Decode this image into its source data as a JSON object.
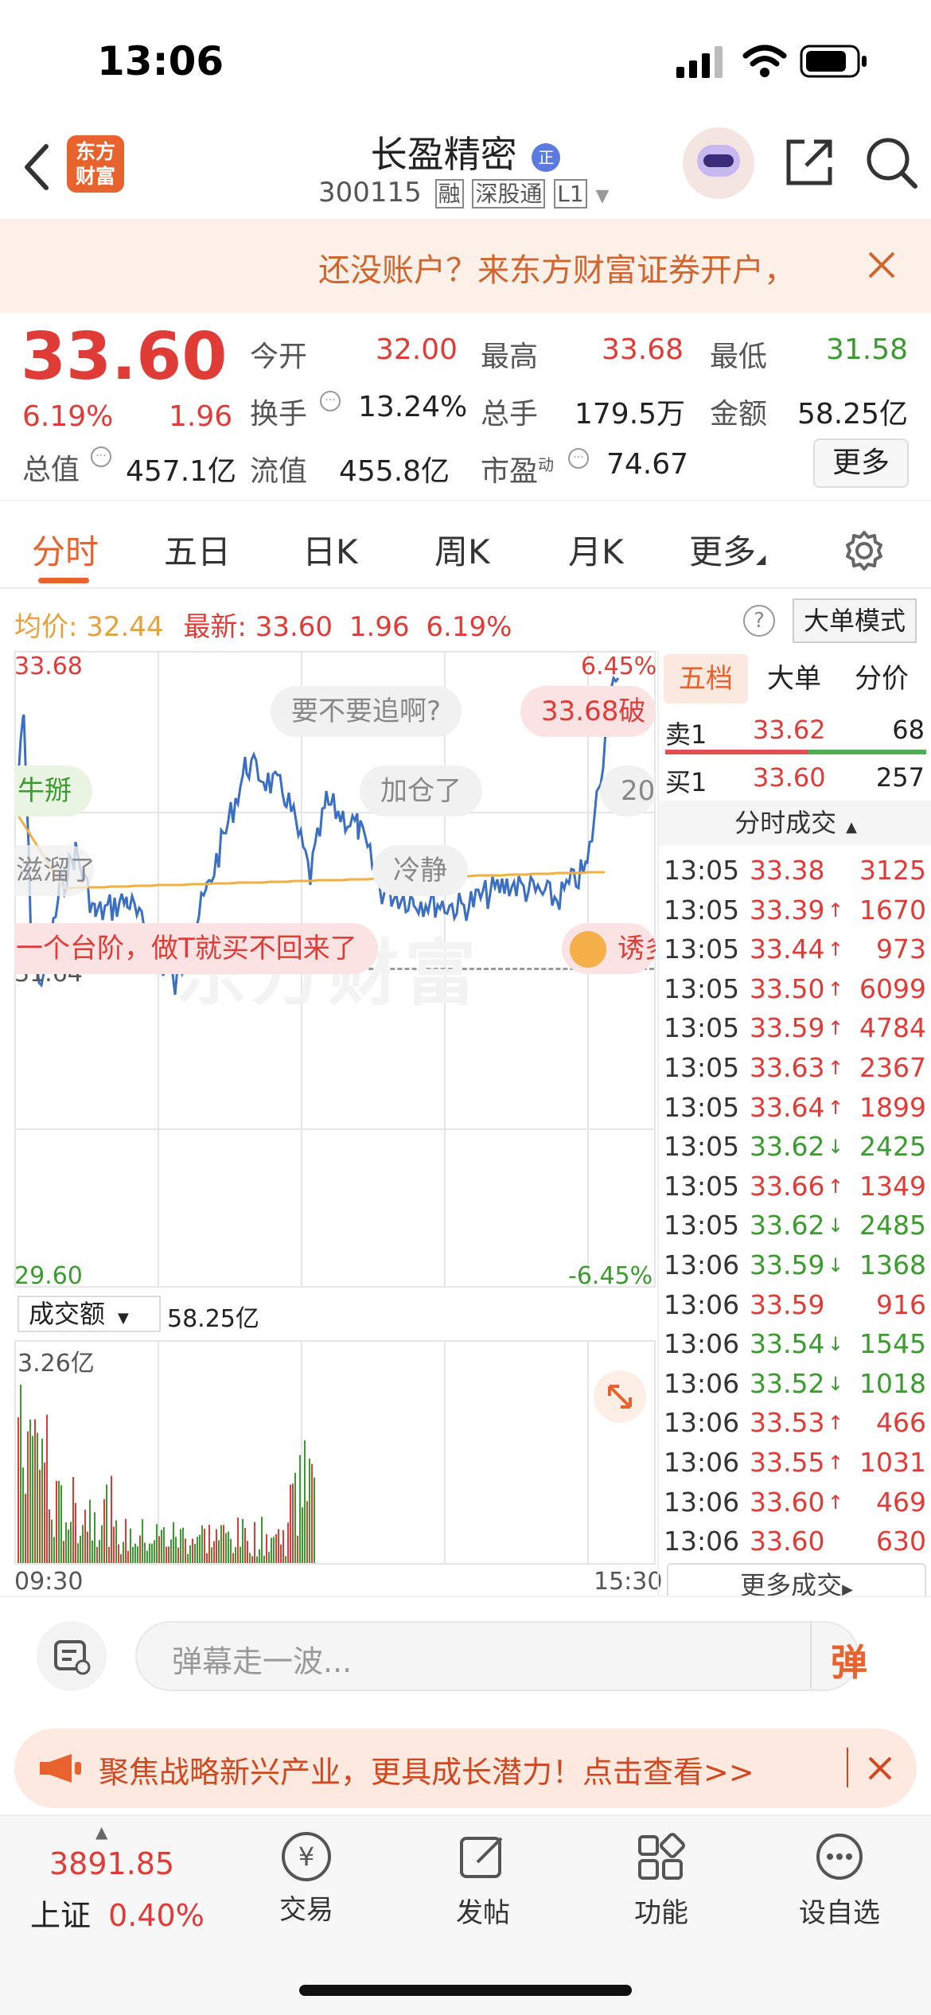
{
  "status_bar": {
    "time": "13:06"
  },
  "nav": {
    "logo_text_top": "东方",
    "logo_text_bottom": "财富",
    "stock_name": "长盈精密",
    "badge": "正",
    "stock_code": "300115",
    "tags": [
      "融",
      "深股通",
      "L1"
    ]
  },
  "banner": {
    "text": "还没账户？来东方财富证券开户，"
  },
  "quote": {
    "price": "33.60",
    "change_pct": "6.19%",
    "change": "1.96",
    "open_label": "今开",
    "open": "32.00",
    "high_label": "最高",
    "high": "33.68",
    "low_label": "最低",
    "low": "31.58",
    "turnover_label": "换手",
    "turnover": "13.24%",
    "volume_label": "总手",
    "volume": "179.5万",
    "amount_label": "金额",
    "amount": "58.25亿",
    "mktcap_label": "总值",
    "mktcap": "457.1亿",
    "float_label": "流值",
    "float": "455.8亿",
    "pe_label": "市盈",
    "pe_sup": "动",
    "pe": "74.67",
    "more_button": "更多"
  },
  "tabs": {
    "items": [
      "分时",
      "五日",
      "日K",
      "周K",
      "月K",
      "更多"
    ],
    "active": 0
  },
  "chart_header": {
    "avg_label": "均价:",
    "avg": "32.44",
    "last_label": "最新:",
    "last": "33.60",
    "last_change": "1.96",
    "last_pct": "6.19%",
    "mode_button": "大单模式"
  },
  "intraday": {
    "y_high": "33.68",
    "y_ref": "31.64",
    "y_low": "29.60",
    "pct_high": "6.45%",
    "pct_low": "-6.45%",
    "volume_selector": "成交额",
    "volume_total": "58.25亿",
    "volume_max": "3.26亿",
    "time_start": "09:30",
    "time_end": "15:30"
  },
  "danmaku_bubbles": [
    "要不要追啊?",
    "33.68破",
    "牛掰",
    "加仓了",
    "20",
    "滋溜了",
    "冷静",
    "一个台阶，做T就买不回来了",
    "诱多"
  ],
  "side_panel": {
    "tabs": [
      "五档",
      "大单",
      "分价"
    ],
    "sell1_label": "卖1",
    "sell1_price": "33.62",
    "sell1_vol": "68",
    "buy1_label": "买1",
    "buy1_price": "33.60",
    "buy1_vol": "257",
    "ticks_title": "分时成交",
    "ticks": [
      {
        "time": "13:05",
        "price": "33.38",
        "arrow": "",
        "vol": "3125",
        "color": "red"
      },
      {
        "time": "13:05",
        "price": "33.39",
        "arrow": "↑",
        "vol": "1670",
        "color": "red"
      },
      {
        "time": "13:05",
        "price": "33.44",
        "arrow": "↑",
        "vol": "973",
        "color": "red"
      },
      {
        "time": "13:05",
        "price": "33.50",
        "arrow": "↑",
        "vol": "6099",
        "color": "red"
      },
      {
        "time": "13:05",
        "price": "33.59",
        "arrow": "↑",
        "vol": "4784",
        "color": "red"
      },
      {
        "time": "13:05",
        "price": "33.63",
        "arrow": "↑",
        "vol": "2367",
        "color": "red"
      },
      {
        "time": "13:05",
        "price": "33.64",
        "arrow": "↑",
        "vol": "1899",
        "color": "red"
      },
      {
        "time": "13:05",
        "price": "33.62",
        "arrow": "↓",
        "vol": "2425",
        "color": "green"
      },
      {
        "time": "13:05",
        "price": "33.66",
        "arrow": "↑",
        "vol": "1349",
        "color": "red"
      },
      {
        "time": "13:05",
        "price": "33.62",
        "arrow": "↓",
        "vol": "2485",
        "color": "green"
      },
      {
        "time": "13:06",
        "price": "33.59",
        "arrow": "↓",
        "vol": "1368",
        "color": "green"
      },
      {
        "time": "13:06",
        "price": "33.59",
        "arrow": "",
        "vol": "916",
        "color": "red"
      },
      {
        "time": "13:06",
        "price": "33.54",
        "arrow": "↓",
        "vol": "1545",
        "color": "green"
      },
      {
        "time": "13:06",
        "price": "33.52",
        "arrow": "↓",
        "vol": "1018",
        "color": "green"
      },
      {
        "time": "13:06",
        "price": "33.53",
        "arrow": "↑",
        "vol": "466",
        "color": "red"
      },
      {
        "time": "13:06",
        "price": "33.55",
        "arrow": "↑",
        "vol": "1031",
        "color": "red"
      },
      {
        "time": "13:06",
        "price": "33.60",
        "arrow": "↑",
        "vol": "469",
        "color": "red"
      },
      {
        "time": "13:06",
        "price": "33.60",
        "arrow": "",
        "vol": "630",
        "color": "red"
      }
    ],
    "more_ticks": "更多成交"
  },
  "danmu_input": {
    "placeholder": "弹幕走一波...",
    "send_label": "弹"
  },
  "promo": {
    "text": "聚焦战略新兴产业，更具成长潜力！点击查看>>"
  },
  "bottom_bar": {
    "index_value": "3891.85",
    "index_name": "上证",
    "index_pct": "0.40%",
    "items": [
      "交易",
      "发帖",
      "功能",
      "设自选"
    ]
  },
  "colors": {
    "up": "#e03c37",
    "down": "#3b9b2f",
    "accent": "#e8622e",
    "avg_line": "#f0b040",
    "price_line": "#3a6fc4"
  }
}
